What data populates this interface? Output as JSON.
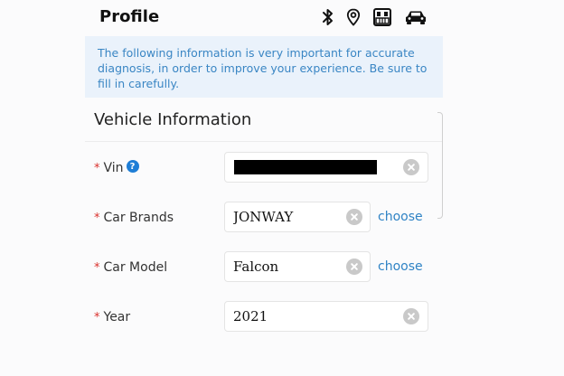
{
  "header": {
    "title": "Profile",
    "icons": [
      "bluetooth-icon",
      "location-pin-icon",
      "obd-connector-icon",
      "car-icon"
    ]
  },
  "notice": {
    "text": "The following information is very important for accurate diagnosis, in order to improve your experience. Be sure to fill in carefully."
  },
  "section": {
    "title": "Vehicle Information"
  },
  "form": {
    "required_mark": "*",
    "vin": {
      "label": "Vin",
      "value": "",
      "redacted": true
    },
    "car_brands": {
      "label": "Car Brands",
      "value": "JONWAY",
      "action": "choose"
    },
    "car_model": {
      "label": "Car Model",
      "value": "Falcon",
      "action": "choose"
    },
    "year": {
      "label": "Year",
      "value": "2021"
    }
  },
  "colors": {
    "accent": "#2f83c5",
    "notice_bg": "#eaf2fb",
    "required": "#d9302c",
    "help": "#1f7ed6"
  }
}
